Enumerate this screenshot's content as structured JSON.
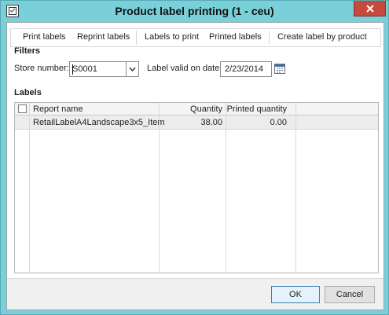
{
  "window": {
    "title": "Product label printing (1 - ceu)",
    "icons": {
      "app": "label-print-icon",
      "close": "close-icon"
    }
  },
  "toolbar": {
    "items": [
      "Print labels",
      "Reprint labels",
      "Labels to print",
      "Printed labels",
      "Create label by product"
    ]
  },
  "filters": {
    "section_title": "Filters",
    "store_label": "Store number:",
    "store_value": "S0001",
    "date_label": "Label valid on date:",
    "date_value": "2/23/2014",
    "icons": {
      "dropdown": "chevron-down-icon",
      "calendar": "calendar-icon"
    }
  },
  "labels": {
    "section_title": "Labels",
    "columns": [
      "Report name",
      "Quantity",
      "Printed quantity"
    ],
    "rows": [
      {
        "report_name": "RetailLabelA4Landscape3x5_Item",
        "quantity": "38.00",
        "printed_quantity": "0.00"
      }
    ]
  },
  "buttons": {
    "ok": "OK",
    "cancel": "Cancel"
  },
  "colors": {
    "frame": "#7ad0d8",
    "close": "#c7483d",
    "selected_row": "#ececec"
  }
}
